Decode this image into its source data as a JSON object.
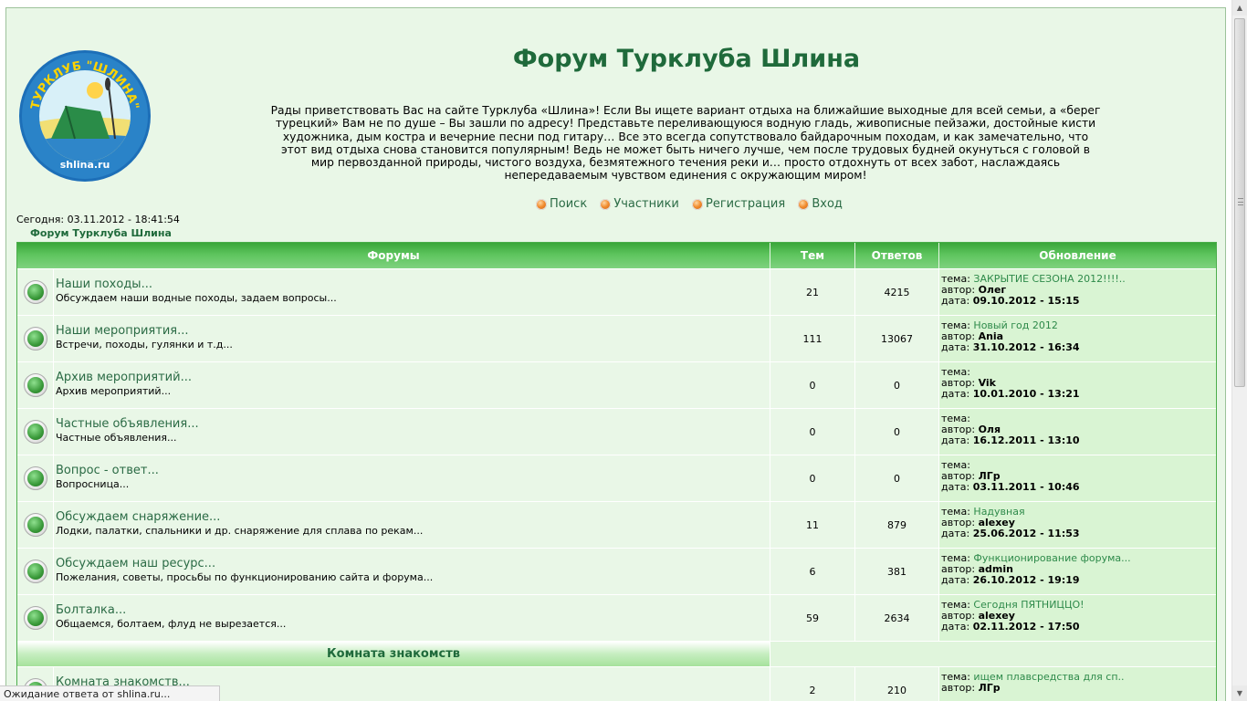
{
  "header": {
    "logo_text_top": "ТУРКЛУБ \"ШЛИНА\"",
    "logo_text_bottom": "shlina.ru",
    "title": "Форум Турклуба Шлина",
    "intro": "Рады приветствовать Вас на сайте Турклуба «Шлина»! Если Вы ищете вариант отдыха на ближайшие выходные для всей семьи, а «берег турецкий» Вам не по душе – Вы зашли по адресу! Представьте переливающуюся водную гладь, живописные пейзажи, достойные кисти художника, дым костра и вечерние песни под гитару… Все это всегда сопутствовало байдарочным походам, и как замечательно, что этот вид отдыха снова становится популярным! Ведь не может быть ничего лучше, чем после трудовых будней окунуться с головой в мир первозданной природы, чистого воздуха, безмятежного течения реки и… просто отдохнуть от всех забот, наслаждаясь непередаваемым чувством единения с окружающим миром!"
  },
  "nav": {
    "search": "Поиск",
    "members": "Участники",
    "register": "Регистрация",
    "login": "Вход"
  },
  "today": "Сегодня: 03.11.2012 - 18:41:54",
  "breadcrumb": "Форум Турклуба Шлина",
  "table": {
    "headers": {
      "forums": "Форумы",
      "topics": "Тем",
      "replies": "Ответов",
      "updated": "Обновление"
    },
    "labels": {
      "topic": "тема:",
      "author": "автор:",
      "date": "дата:"
    },
    "rows": [
      {
        "title": "Наши походы...",
        "desc": "Обсуждаем наши водные походы, задаем вопросы...",
        "topics": "21",
        "replies": "4215",
        "last_topic": "ЗАКРЫТИЕ СЕЗОНА 2012!!!!..",
        "author": "Олег",
        "date": "09.10.2012 - 15:15"
      },
      {
        "title": "Наши мероприятия...",
        "desc": "Встречи, походы, гулянки и т.д...",
        "topics": "111",
        "replies": "13067",
        "last_topic": "Новый год 2012",
        "author": "Ania",
        "date": "31.10.2012 - 16:34"
      },
      {
        "title": "Архив мероприятий...",
        "desc": "Архив мероприятий...",
        "topics": "0",
        "replies": "0",
        "last_topic": "",
        "author": "Vik",
        "date": "10.01.2010 - 13:21"
      },
      {
        "title": "Частные объявления...",
        "desc": "Частные объявления...",
        "topics": "0",
        "replies": "0",
        "last_topic": "",
        "author": "Оля",
        "date": "16.12.2011 - 13:10"
      },
      {
        "title": "Вопрос - ответ...",
        "desc": "Вопросница...",
        "topics": "0",
        "replies": "0",
        "last_topic": "",
        "author": "ЛГр",
        "date": "03.11.2011 - 10:46"
      },
      {
        "title": "Обсуждаем снаряжение...",
        "desc": "Лодки, палатки, спальники и др. снаряжение для сплава по рекам...",
        "topics": "11",
        "replies": "879",
        "last_topic": "Надувная",
        "author": "alexey",
        "date": "25.06.2012 - 11:53"
      },
      {
        "title": "Обсуждаем наш ресурс...",
        "desc": "Пожелания, советы, просьбы по функционированию сайта и форума...",
        "topics": "6",
        "replies": "381",
        "last_topic": "Функционирование форума...",
        "author": "admin",
        "date": "26.10.2012 - 19:19"
      },
      {
        "title": "Болталка...",
        "desc": "Общаемся, болтаем, флуд не вырезается...",
        "topics": "59",
        "replies": "2634",
        "last_topic": "Сегодня ПЯТНИЦЦО!",
        "author": "alexey",
        "date": "02.11.2012 - 17:50"
      }
    ],
    "section2": {
      "title": "Комната знакомств",
      "row": {
        "title": "Комната знакомств...",
        "topics": "2",
        "replies": "210",
        "last_topic": "ищем плавсредства для сп..",
        "author": "ЛГр"
      }
    }
  },
  "status": "Ожидание ответа от shlina.ru..."
}
